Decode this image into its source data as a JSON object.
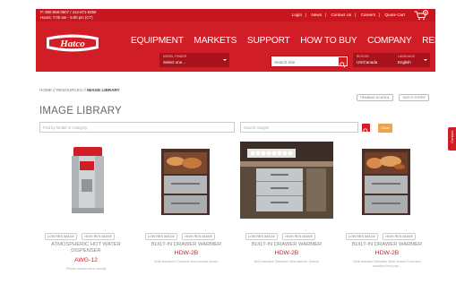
{
  "topbar": {
    "phone": "P: 800-558-0607 / 414-671-6350",
    "hours": "Hours: 7:00 am - 5:00 pm (CT)",
    "links": [
      "Login",
      "News",
      "Contact Us",
      "Careers",
      "Quote Cart"
    ],
    "separator": "|",
    "cart_count": "0"
  },
  "header": {
    "logo_text": "Hatco",
    "nav": [
      "EQUIPMENT",
      "MARKETS",
      "SUPPORT",
      "HOW TO BUY",
      "COMPANY",
      "RESOURCES"
    ],
    "model_finder": {
      "caption": "MODEL FINDER",
      "value": "Select one..."
    },
    "search": {
      "placeholder": "Search Site"
    },
    "region": {
      "caption": "REGION",
      "value": "US/Canada"
    },
    "language": {
      "caption": "LANGUAGE",
      "value": "English"
    }
  },
  "feedback_label": "Contact",
  "breadcrumb": {
    "home": "HOME",
    "resources": "RESOURCES",
    "current": "IMAGE LIBRARY",
    "sep": "//"
  },
  "subnav": [
    "TRAINING SCHOOL",
    "HATCO STORY"
  ],
  "page_title": "IMAGE LIBRARY",
  "filters": {
    "category_placeholder": "Find by Model or Category",
    "keyword_placeholder": "Search Images",
    "clear_label": "Clear"
  },
  "products": [
    {
      "name": "ATMOSPHERIC HOT WATER DISPENSER",
      "model": "AWG-12",
      "desc": "(Printer should set to actual)",
      "low_res": "LOW RES IMAGE",
      "high_res": "HIGH RES IMAGE"
    },
    {
      "name": "BUILT-IN DRAWER WARMER",
      "model": "HDW-2B",
      "desc": "Built standard 2 Drawers front access shown",
      "low_res": "LOW RES IMAGE",
      "high_res": "HIGH RES IMAGE"
    },
    {
      "name": "BUILT-IN DRAWER WARMER",
      "model": "HDW-2B",
      "desc": "Built standard Stainless Steel warmer Drawer",
      "low_res": "LOW RES IMAGE",
      "high_res": "HIGH RES IMAGE"
    },
    {
      "name": "BUILT-IN DRAWER WARMER",
      "model": "HDW-2B",
      "desc": "Built standard Stainless Steel drawer Food and standard food pan...",
      "low_res": "LOW RES IMAGE",
      "high_res": "HIGH RES IMAGE"
    }
  ],
  "colors": {
    "brand_red": "#d11e26",
    "dark_red": "#a8121a",
    "clear_orange": "#f0a24a"
  }
}
